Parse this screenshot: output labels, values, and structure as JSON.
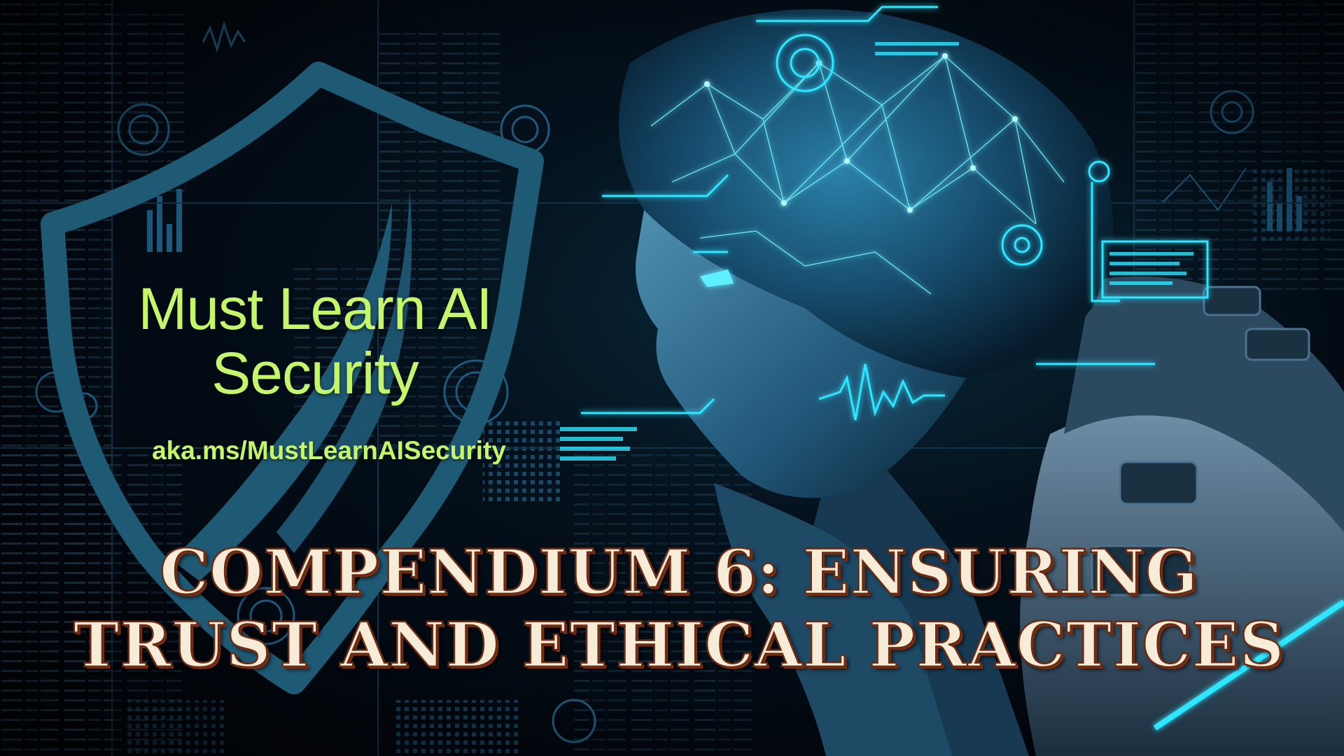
{
  "brand": {
    "title_line1": "Must Learn AI",
    "title_line2": "Security",
    "url": "aka.ms/MustLearnAISecurity"
  },
  "headline": {
    "line1": "COMPENDIUM 6: ENSURING",
    "line2": "TRUST AND ETHICAL PRACTICES"
  },
  "colors": {
    "brand_text": "#c5f56a",
    "shield": "#1f5a75",
    "headline_fill": "#f7ecd7",
    "headline_outline": "#6b2a12",
    "neon_cyan": "#2ee6ff",
    "background": "#02060c"
  },
  "icons": {
    "shield": "shield-logo",
    "robot": "robot-head-illustration",
    "hud": "hud-interface-graphics"
  }
}
